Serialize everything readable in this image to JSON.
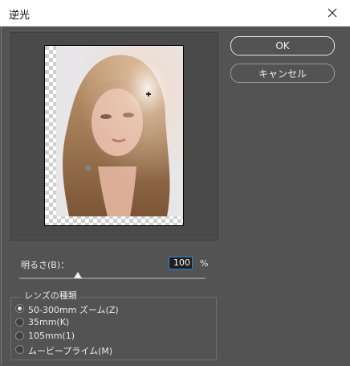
{
  "window": {
    "title": "逆光"
  },
  "buttons": {
    "ok": "OK",
    "cancel": "キャンセル"
  },
  "brightness": {
    "label": "明るさ(B)：",
    "value": "100",
    "unit": "%",
    "slider_fraction": 0.31
  },
  "lens": {
    "group_title": "レンズの種類",
    "options": [
      {
        "label": "50-300mm ズーム(Z)",
        "selected": true
      },
      {
        "label": "35mm(K)",
        "selected": false
      },
      {
        "label": "105mm(1)",
        "selected": false
      },
      {
        "label": "ムービープライム(M)",
        "selected": false
      }
    ]
  },
  "preview": {
    "description_icon": "crosshair-icon"
  }
}
